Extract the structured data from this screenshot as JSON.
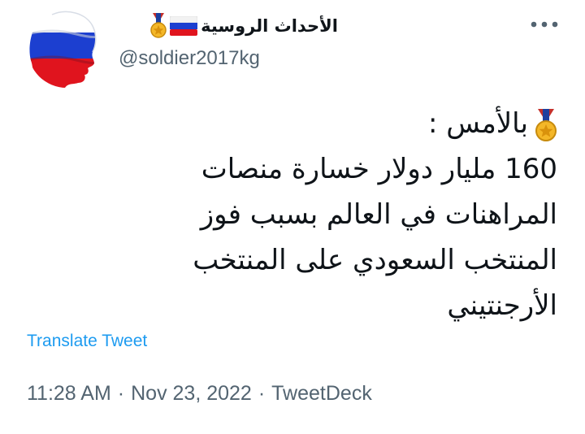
{
  "tweet": {
    "author": {
      "display_name": "الأحداث الروسية",
      "handle": "@soldier2017kg",
      "avatar_icon": "russian-flag-avatar-icon",
      "badges": [
        "medal-icon",
        "russian-flag-icon"
      ]
    },
    "more_icon": "more-dots-icon",
    "body_lines": [
      "بالأمس :",
      "160 مليار دولار خسارة منصات",
      "المراهنات في العالم بسبب فوز",
      "المنتخب السعودي على المنتخب",
      "الأرجنتيني"
    ],
    "translate_label": "Translate Tweet",
    "time": "11:28 AM",
    "separator": "·",
    "date": "Nov 23, 2022",
    "source": "TweetDeck"
  },
  "colors": {
    "text_primary": "#0f1419",
    "text_secondary": "#536471",
    "link": "#1d9bf0",
    "flag_white": "#ffffff",
    "flag_blue": "#1c3fd0",
    "flag_red": "#e0141e",
    "medal_gold": "#f4b728"
  }
}
